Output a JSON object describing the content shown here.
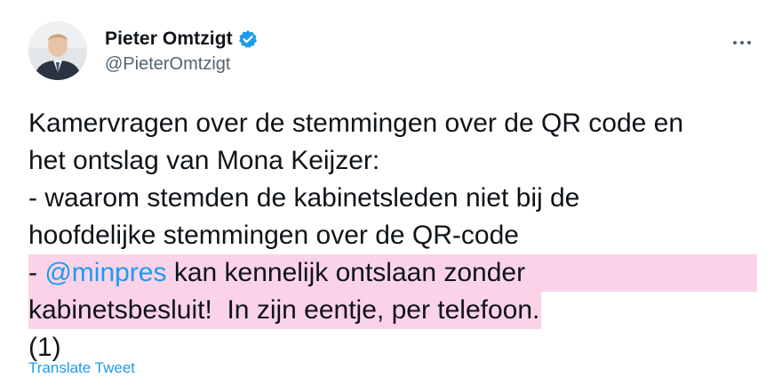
{
  "author": {
    "name": "Pieter Omtzigt",
    "handle": "@PieterOmtzigt",
    "verified": true,
    "avatar_icon": "profile-photo"
  },
  "tweet": {
    "lines": [
      {
        "text": "Kamervragen over de stemmingen over de QR code en"
      },
      {
        "text": "het ontslag van Mona Keijzer:"
      },
      {
        "text": "- waarom stemden de kabinetsleden niet bij de"
      },
      {
        "text": "hoofdelijke stemmingen over de QR-code"
      },
      {
        "prefix": "- ",
        "mention": "@minpres",
        "text": " kan kennelijk ontslaan zonder"
      },
      {
        "text": "kabinetsbesluit!  In zijn eentje, per telefoon."
      },
      {
        "text": "(1)"
      }
    ],
    "highlight_color": "#fbd3e9"
  },
  "actions": {
    "translate_label": "Translate Tweet",
    "more_icon": "more-horizontal-icon"
  },
  "colors": {
    "link": "#1d9bf0",
    "text": "#0f1419",
    "secondary": "#536471",
    "verified": "#1d9bf0"
  }
}
